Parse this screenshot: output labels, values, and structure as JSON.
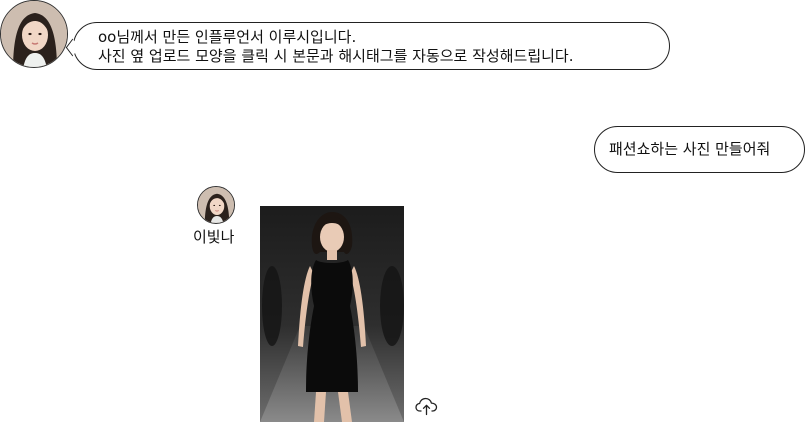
{
  "intro": {
    "line1": "oo님께서 만든 인플루언서 이루시입니다.",
    "line2": "사진 옆 업로드 모양을 클릭 시 본문과 해시태그를 자동으로 작성해드립니다."
  },
  "user_message": "패션쇼하는 사진 만들어줘",
  "persona": {
    "name": "이빛나"
  },
  "icons": {
    "upload": "cloud-upload-icon"
  },
  "colors": {
    "border": "#222222",
    "text": "#111111",
    "background": "#ffffff",
    "dress": "#0b0b0b"
  }
}
